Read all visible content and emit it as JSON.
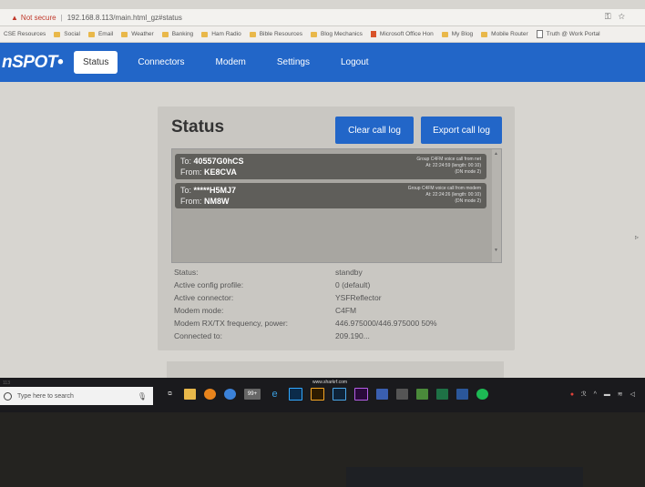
{
  "browser": {
    "security_label": "Not secure",
    "url": "192.168.8.113/main.html_gz#status",
    "bookmarks": [
      {
        "label": "CSE Resources",
        "icon": "none"
      },
      {
        "label": "Social",
        "icon": "folder-icon"
      },
      {
        "label": "Email",
        "icon": "folder-icon"
      },
      {
        "label": "Weather",
        "icon": "folder-icon"
      },
      {
        "label": "Banking",
        "icon": "folder-icon"
      },
      {
        "label": "Ham Radio",
        "icon": "folder-icon"
      },
      {
        "label": "Bible Resources",
        "icon": "folder-icon"
      },
      {
        "label": "Blog Mechanics",
        "icon": "folder-icon"
      },
      {
        "label": "Microsoft Office Hon",
        "icon": "office-icon"
      },
      {
        "label": "My Blog",
        "icon": "folder-icon"
      },
      {
        "label": "Mobile Router",
        "icon": "folder-icon"
      },
      {
        "label": "Truth @ Work Portal",
        "icon": "page-icon"
      }
    ]
  },
  "nav": {
    "logo": "nSPOT",
    "items": [
      "Status",
      "Connectors",
      "Modem",
      "Settings",
      "Logout"
    ],
    "active": "Status"
  },
  "status_card": {
    "title": "Status",
    "clear_button": "Clear call log",
    "export_button": "Export call log",
    "log_entries": [
      {
        "to_label": "To:",
        "to": "40557G0hCS",
        "from_label": "From:",
        "from": "KE8CVA",
        "info1": "Group C4FM voice call from net",
        "info2": "At: 22:24:59 (length: 00:10)",
        "info3": "(DN mode 2)"
      },
      {
        "to_label": "To:",
        "to": "*****H5MJ7",
        "from_label": "From:",
        "from": "NM8W",
        "info1": "Group C4FM voice call from modem",
        "info2": "At: 22:24:26 (length: 00:10)",
        "info3": "(DN mode 2)"
      }
    ],
    "properties": [
      {
        "label": "Status:",
        "value": "standby"
      },
      {
        "label": "Active config profile:",
        "value": "0 (default)"
      },
      {
        "label": "Active connector:",
        "value": "YSFReflector"
      },
      {
        "label": "Modem mode:",
        "value": "C4FM"
      },
      {
        "label": "Modem RX/TX frequency, power:",
        "value": "446.975000/446.975000 50%"
      },
      {
        "label": "Connected to:",
        "value": "209.190..."
      }
    ]
  },
  "statusbar": {
    "left_text": "113",
    "center_text": "www.sharkrf.com"
  },
  "taskbar": {
    "search_placeholder": "Type here to search",
    "mail_badge": "99+"
  }
}
